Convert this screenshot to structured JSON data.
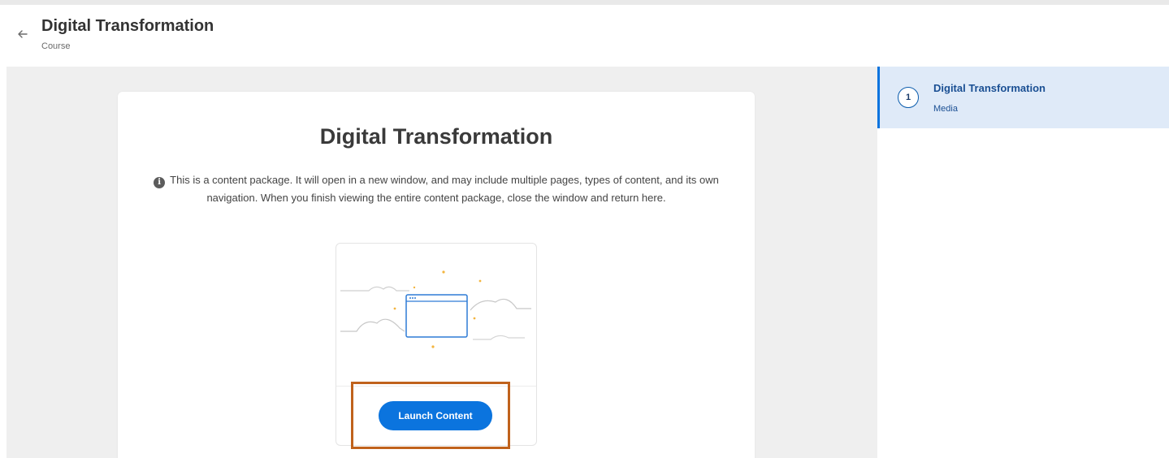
{
  "header": {
    "title": "Digital Transformation",
    "subtitle": "Course",
    "back_icon": "arrow-left-icon"
  },
  "content": {
    "title": "Digital Transformation",
    "info_icon": "info-circle-icon",
    "info_text": "This is a content package. It will open in a new window, and may include multiple pages, types of content, and its own navigation. When you finish viewing the entire content package, close the window and return here.",
    "launch_label": "Launch Content"
  },
  "sidebar": {
    "items": [
      {
        "number": "1",
        "title": "Digital Transformation",
        "type": "Media"
      }
    ]
  },
  "colors": {
    "accent": "#0b74de",
    "selected_bg": "#dfeaf8",
    "highlight_border": "#c0621c"
  }
}
